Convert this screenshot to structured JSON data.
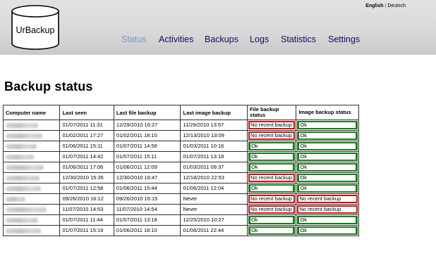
{
  "header": {
    "logo_text": "UrBackup",
    "languages": [
      "English",
      "Deutsch"
    ],
    "nav": [
      {
        "label": "Status",
        "active": true
      },
      {
        "label": "Activities",
        "active": false
      },
      {
        "label": "Backups",
        "active": false
      },
      {
        "label": "Logs",
        "active": false
      },
      {
        "label": "Statistics",
        "active": false
      },
      {
        "label": "Settings",
        "active": false
      }
    ]
  },
  "page_title": "Backup status",
  "table": {
    "columns": [
      "Computer name",
      "Last seen",
      "Last file backup",
      "Last image backup",
      "File backup status",
      "Image backup status"
    ],
    "rows": [
      {
        "name": "",
        "last_seen": "01/07/2011 11:31",
        "last_file": "12/29/2010 16:27",
        "last_image": "11/29/2010 13:57",
        "file_status": "No recent backup",
        "image_status": "Ok"
      },
      {
        "name": "",
        "last_seen": "01/02/2011 17:27",
        "last_file": "01/02/2011 18:10",
        "last_image": "12/13/2010 13:09",
        "file_status": "No recent backup",
        "image_status": "Ok"
      },
      {
        "name": "",
        "last_seen": "01/06/2011 15:11",
        "last_file": "01/07/2011 14:56",
        "last_image": "01/03/2011 10:16",
        "file_status": "Ok",
        "image_status": "Ok"
      },
      {
        "name": "",
        "last_seen": "01/07/2011 14:42",
        "last_file": "01/07/2011 15:11",
        "last_image": "01/07/2011 13:18",
        "file_status": "Ok",
        "image_status": "Ok"
      },
      {
        "name": "",
        "last_seen": "01/06/2011 17:06",
        "last_file": "01/06/2011 12:09",
        "last_image": "01/03/2011 09:37",
        "file_status": "Ok",
        "image_status": "Ok"
      },
      {
        "name": "",
        "last_seen": "12/30/2010 15:35",
        "last_file": "12/30/2010 16:47",
        "last_image": "12/18/2010 22:53",
        "file_status": "No recent backup",
        "image_status": "Ok"
      },
      {
        "name": "",
        "last_seen": "01/07/2011 12:58",
        "last_file": "01/06/2011 15:44",
        "last_image": "01/06/2011 12:04",
        "file_status": "Ok",
        "image_status": "Ok"
      },
      {
        "name": "",
        "last_seen": "09/26/2010 16:12",
        "last_file": "09/26/2010 16:15",
        "last_image": "Never",
        "file_status": "No recent backup",
        "image_status": "No recent backup"
      },
      {
        "name": "",
        "last_seen": "11/07/2010 14:53",
        "last_file": "11/07/2010 14:54",
        "last_image": "Never",
        "file_status": "No recent backup",
        "image_status": "No recent backup"
      },
      {
        "name": "",
        "last_seen": "01/07/2011 11:44",
        "last_file": "01/07/2011 13:18",
        "last_image": "12/25/2010 10:27",
        "file_status": "Ok",
        "image_status": "Ok"
      },
      {
        "name": "",
        "last_seen": "01/07/2011 15:19",
        "last_file": "01/06/2011 18:10",
        "last_image": "01/06/2011 22:44",
        "file_status": "Ok",
        "image_status": "Ok"
      }
    ]
  },
  "colors": {
    "ok": "#1f7a1f",
    "bad": "#c21818",
    "nav_active": "#7f93c9",
    "nav": "#10105a"
  }
}
